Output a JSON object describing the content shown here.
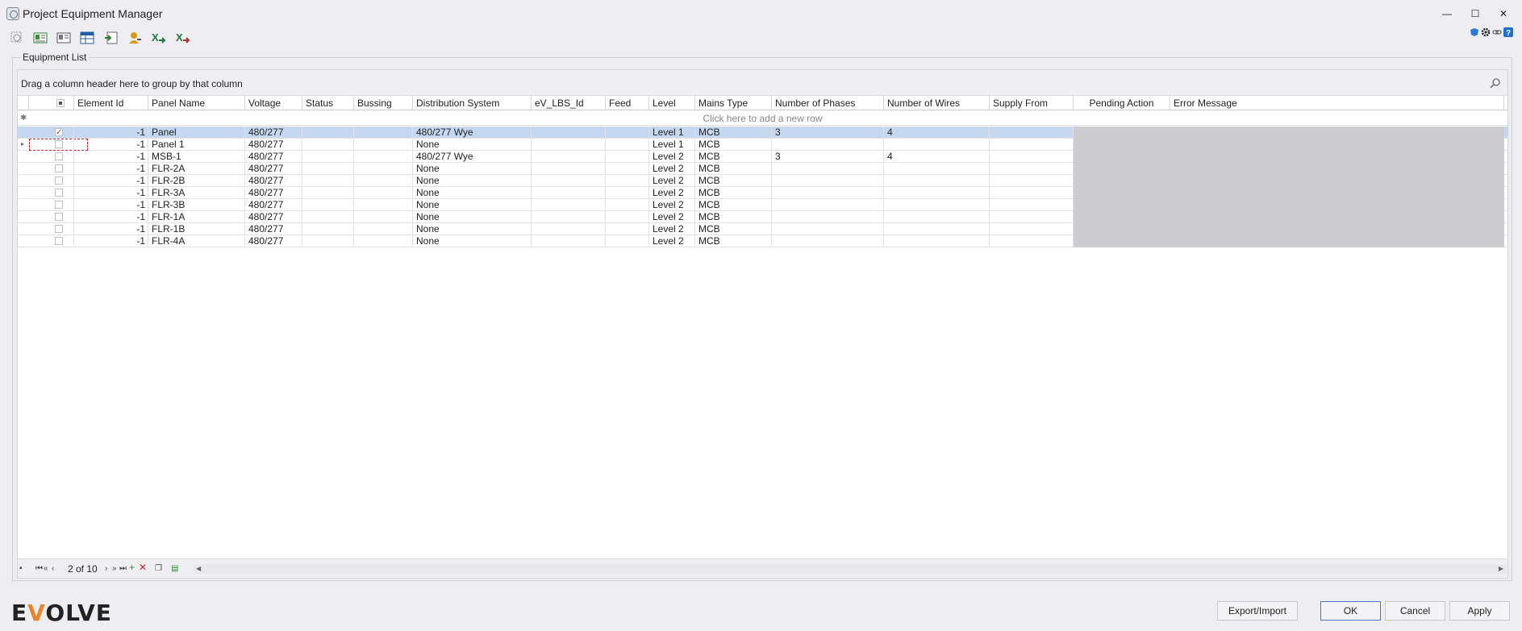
{
  "window": {
    "title": "Project Equipment Manager",
    "minimize": "—",
    "maximize": "☐",
    "close": "✕"
  },
  "group": {
    "title": "Equipment List",
    "drag_hint": "Drag a column header here to group by that column",
    "new_row_hint": "Click here to add a new row"
  },
  "columns": [
    {
      "key": "checkbox",
      "label": ""
    },
    {
      "key": "element_id",
      "label": "Element Id"
    },
    {
      "key": "panel_name",
      "label": "Panel Name"
    },
    {
      "key": "voltage",
      "label": "Voltage"
    },
    {
      "key": "status",
      "label": "Status"
    },
    {
      "key": "bussing",
      "label": "Bussing"
    },
    {
      "key": "distribution_system",
      "label": "Distribution System"
    },
    {
      "key": "ev_lbs_id",
      "label": "eV_LBS_Id"
    },
    {
      "key": "feed",
      "label": "Feed"
    },
    {
      "key": "level",
      "label": "Level"
    },
    {
      "key": "mains_type",
      "label": "Mains Type"
    },
    {
      "key": "number_of_phases",
      "label": "Number of Phases"
    },
    {
      "key": "number_of_wires",
      "label": "Number of Wires"
    },
    {
      "key": "supply_from",
      "label": "Supply From"
    },
    {
      "key": "pending_action",
      "label": "Pending Action"
    },
    {
      "key": "error_message",
      "label": "Error Message"
    }
  ],
  "rows": [
    {
      "checked": true,
      "element_id": "-1",
      "panel_name": "Panel",
      "voltage": "480/277",
      "status": "",
      "bussing": "",
      "distribution_system": "480/277 Wye",
      "ev_lbs_id": "",
      "feed": "",
      "level": "Level 1",
      "mains_type": "MCB",
      "number_of_phases": "3",
      "number_of_wires": "4",
      "supply_from": "",
      "pending_action": "",
      "error_message": ""
    },
    {
      "checked": false,
      "element_id": "-1",
      "panel_name": "Panel 1",
      "voltage": "480/277",
      "status": "",
      "bussing": "",
      "distribution_system": "None",
      "ev_lbs_id": "",
      "feed": "",
      "level": "Level 1",
      "mains_type": "MCB",
      "number_of_phases": "",
      "number_of_wires": "",
      "supply_from": "",
      "pending_action": "",
      "error_message": ""
    },
    {
      "checked": false,
      "element_id": "-1",
      "panel_name": "MSB-1",
      "voltage": "480/277",
      "status": "",
      "bussing": "",
      "distribution_system": "480/277 Wye",
      "ev_lbs_id": "",
      "feed": "",
      "level": "Level 2",
      "mains_type": "MCB",
      "number_of_phases": "3",
      "number_of_wires": "4",
      "supply_from": "",
      "pending_action": "",
      "error_message": ""
    },
    {
      "checked": false,
      "element_id": "-1",
      "panel_name": "FLR-2A",
      "voltage": "480/277",
      "status": "",
      "bussing": "",
      "distribution_system": "None",
      "ev_lbs_id": "",
      "feed": "",
      "level": "Level 2",
      "mains_type": "MCB",
      "number_of_phases": "",
      "number_of_wires": "",
      "supply_from": "",
      "pending_action": "",
      "error_message": ""
    },
    {
      "checked": false,
      "element_id": "-1",
      "panel_name": "FLR-2B",
      "voltage": "480/277",
      "status": "",
      "bussing": "",
      "distribution_system": "None",
      "ev_lbs_id": "",
      "feed": "",
      "level": "Level 2",
      "mains_type": "MCB",
      "number_of_phases": "",
      "number_of_wires": "",
      "supply_from": "",
      "pending_action": "",
      "error_message": ""
    },
    {
      "checked": false,
      "element_id": "-1",
      "panel_name": "FLR-3A",
      "voltage": "480/277",
      "status": "",
      "bussing": "",
      "distribution_system": "None",
      "ev_lbs_id": "",
      "feed": "",
      "level": "Level 2",
      "mains_type": "MCB",
      "number_of_phases": "",
      "number_of_wires": "",
      "supply_from": "",
      "pending_action": "",
      "error_message": ""
    },
    {
      "checked": false,
      "element_id": "-1",
      "panel_name": "FLR-3B",
      "voltage": "480/277",
      "status": "",
      "bussing": "",
      "distribution_system": "None",
      "ev_lbs_id": "",
      "feed": "",
      "level": "Level 2",
      "mains_type": "MCB",
      "number_of_phases": "",
      "number_of_wires": "",
      "supply_from": "",
      "pending_action": "",
      "error_message": ""
    },
    {
      "checked": false,
      "element_id": "-1",
      "panel_name": "FLR-1A",
      "voltage": "480/277",
      "status": "",
      "bussing": "",
      "distribution_system": "None",
      "ev_lbs_id": "",
      "feed": "",
      "level": "Level 2",
      "mains_type": "MCB",
      "number_of_phases": "",
      "number_of_wires": "",
      "supply_from": "",
      "pending_action": "",
      "error_message": ""
    },
    {
      "checked": false,
      "element_id": "-1",
      "panel_name": "FLR-1B",
      "voltage": "480/277",
      "status": "",
      "bussing": "",
      "distribution_system": "None",
      "ev_lbs_id": "",
      "feed": "",
      "level": "Level 2",
      "mains_type": "MCB",
      "number_of_phases": "",
      "number_of_wires": "",
      "supply_from": "",
      "pending_action": "",
      "error_message": ""
    },
    {
      "checked": false,
      "element_id": "-1",
      "panel_name": "FLR-4A",
      "voltage": "480/277",
      "status": "",
      "bussing": "",
      "distribution_system": "None",
      "ev_lbs_id": "",
      "feed": "",
      "level": "Level 2",
      "mains_type": "MCB",
      "number_of_phases": "",
      "number_of_wires": "",
      "supply_from": "",
      "pending_action": "",
      "error_message": ""
    }
  ],
  "navigator": {
    "record_label": "2 of 10"
  },
  "footer": {
    "logo_pre": "E",
    "logo_v": "V",
    "logo_post": "OLVE",
    "export_import": "Export/Import",
    "ok": "OK",
    "cancel": "Cancel",
    "apply": "Apply"
  },
  "icons": {
    "toolbar": [
      "zoom-icon",
      "grid-view-icon",
      "card-view-icon",
      "table-icon",
      "import-icon",
      "key-user-icon",
      "excel-import-icon",
      "excel-export-icon"
    ],
    "top_right": [
      "shield-icon",
      "gear-icon",
      "link-icon",
      "help-icon"
    ]
  },
  "colors": {
    "selected_row": "#c6d8f0",
    "readonly_cells": "#cdcdd0",
    "logo_accent": "#e8852a"
  }
}
